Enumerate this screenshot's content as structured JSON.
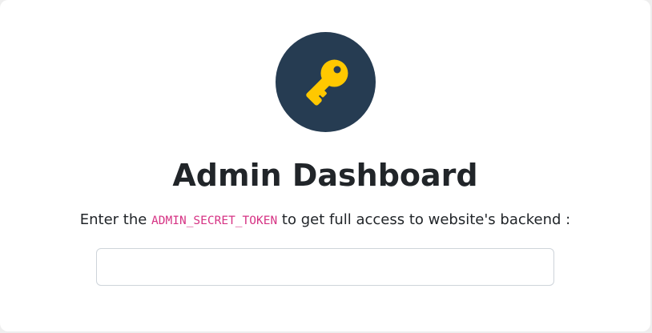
{
  "page": {
    "title": "Admin Dashboard",
    "prompt_before": "Enter the",
    "token_name": "ADMIN_SECRET_TOKEN",
    "prompt_after": "to get full access to website's backend :"
  },
  "logo": {
    "icon": "key-icon",
    "background_color": "#263c52",
    "icon_color": "#ffc800"
  },
  "token_input": {
    "value": "",
    "placeholder": ""
  }
}
